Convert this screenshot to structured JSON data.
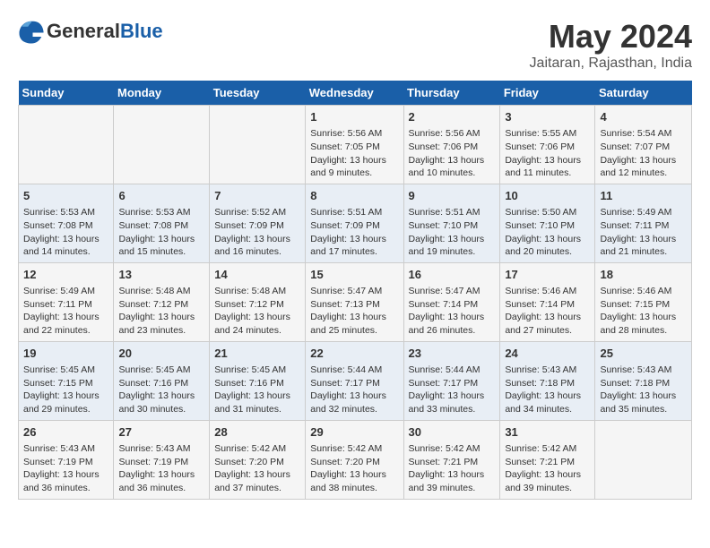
{
  "header": {
    "logo_general": "General",
    "logo_blue": "Blue",
    "month_year": "May 2024",
    "location": "Jaitaran, Rajasthan, India"
  },
  "days_of_week": [
    "Sunday",
    "Monday",
    "Tuesday",
    "Wednesday",
    "Thursday",
    "Friday",
    "Saturday"
  ],
  "weeks": [
    [
      {
        "day": "",
        "content": ""
      },
      {
        "day": "",
        "content": ""
      },
      {
        "day": "",
        "content": ""
      },
      {
        "day": "1",
        "content": "Sunrise: 5:56 AM\nSunset: 7:05 PM\nDaylight: 13 hours\nand 9 minutes."
      },
      {
        "day": "2",
        "content": "Sunrise: 5:56 AM\nSunset: 7:06 PM\nDaylight: 13 hours\nand 10 minutes."
      },
      {
        "day": "3",
        "content": "Sunrise: 5:55 AM\nSunset: 7:06 PM\nDaylight: 13 hours\nand 11 minutes."
      },
      {
        "day": "4",
        "content": "Sunrise: 5:54 AM\nSunset: 7:07 PM\nDaylight: 13 hours\nand 12 minutes."
      }
    ],
    [
      {
        "day": "5",
        "content": "Sunrise: 5:53 AM\nSunset: 7:08 PM\nDaylight: 13 hours\nand 14 minutes."
      },
      {
        "day": "6",
        "content": "Sunrise: 5:53 AM\nSunset: 7:08 PM\nDaylight: 13 hours\nand 15 minutes."
      },
      {
        "day": "7",
        "content": "Sunrise: 5:52 AM\nSunset: 7:09 PM\nDaylight: 13 hours\nand 16 minutes."
      },
      {
        "day": "8",
        "content": "Sunrise: 5:51 AM\nSunset: 7:09 PM\nDaylight: 13 hours\nand 17 minutes."
      },
      {
        "day": "9",
        "content": "Sunrise: 5:51 AM\nSunset: 7:10 PM\nDaylight: 13 hours\nand 19 minutes."
      },
      {
        "day": "10",
        "content": "Sunrise: 5:50 AM\nSunset: 7:10 PM\nDaylight: 13 hours\nand 20 minutes."
      },
      {
        "day": "11",
        "content": "Sunrise: 5:49 AM\nSunset: 7:11 PM\nDaylight: 13 hours\nand 21 minutes."
      }
    ],
    [
      {
        "day": "12",
        "content": "Sunrise: 5:49 AM\nSunset: 7:11 PM\nDaylight: 13 hours\nand 22 minutes."
      },
      {
        "day": "13",
        "content": "Sunrise: 5:48 AM\nSunset: 7:12 PM\nDaylight: 13 hours\nand 23 minutes."
      },
      {
        "day": "14",
        "content": "Sunrise: 5:48 AM\nSunset: 7:12 PM\nDaylight: 13 hours\nand 24 minutes."
      },
      {
        "day": "15",
        "content": "Sunrise: 5:47 AM\nSunset: 7:13 PM\nDaylight: 13 hours\nand 25 minutes."
      },
      {
        "day": "16",
        "content": "Sunrise: 5:47 AM\nSunset: 7:14 PM\nDaylight: 13 hours\nand 26 minutes."
      },
      {
        "day": "17",
        "content": "Sunrise: 5:46 AM\nSunset: 7:14 PM\nDaylight: 13 hours\nand 27 minutes."
      },
      {
        "day": "18",
        "content": "Sunrise: 5:46 AM\nSunset: 7:15 PM\nDaylight: 13 hours\nand 28 minutes."
      }
    ],
    [
      {
        "day": "19",
        "content": "Sunrise: 5:45 AM\nSunset: 7:15 PM\nDaylight: 13 hours\nand 29 minutes."
      },
      {
        "day": "20",
        "content": "Sunrise: 5:45 AM\nSunset: 7:16 PM\nDaylight: 13 hours\nand 30 minutes."
      },
      {
        "day": "21",
        "content": "Sunrise: 5:45 AM\nSunset: 7:16 PM\nDaylight: 13 hours\nand 31 minutes."
      },
      {
        "day": "22",
        "content": "Sunrise: 5:44 AM\nSunset: 7:17 PM\nDaylight: 13 hours\nand 32 minutes."
      },
      {
        "day": "23",
        "content": "Sunrise: 5:44 AM\nSunset: 7:17 PM\nDaylight: 13 hours\nand 33 minutes."
      },
      {
        "day": "24",
        "content": "Sunrise: 5:43 AM\nSunset: 7:18 PM\nDaylight: 13 hours\nand 34 minutes."
      },
      {
        "day": "25",
        "content": "Sunrise: 5:43 AM\nSunset: 7:18 PM\nDaylight: 13 hours\nand 35 minutes."
      }
    ],
    [
      {
        "day": "26",
        "content": "Sunrise: 5:43 AM\nSunset: 7:19 PM\nDaylight: 13 hours\nand 36 minutes."
      },
      {
        "day": "27",
        "content": "Sunrise: 5:43 AM\nSunset: 7:19 PM\nDaylight: 13 hours\nand 36 minutes."
      },
      {
        "day": "28",
        "content": "Sunrise: 5:42 AM\nSunset: 7:20 PM\nDaylight: 13 hours\nand 37 minutes."
      },
      {
        "day": "29",
        "content": "Sunrise: 5:42 AM\nSunset: 7:20 PM\nDaylight: 13 hours\nand 38 minutes."
      },
      {
        "day": "30",
        "content": "Sunrise: 5:42 AM\nSunset: 7:21 PM\nDaylight: 13 hours\nand 39 minutes."
      },
      {
        "day": "31",
        "content": "Sunrise: 5:42 AM\nSunset: 7:21 PM\nDaylight: 13 hours\nand 39 minutes."
      },
      {
        "day": "",
        "content": ""
      }
    ]
  ]
}
